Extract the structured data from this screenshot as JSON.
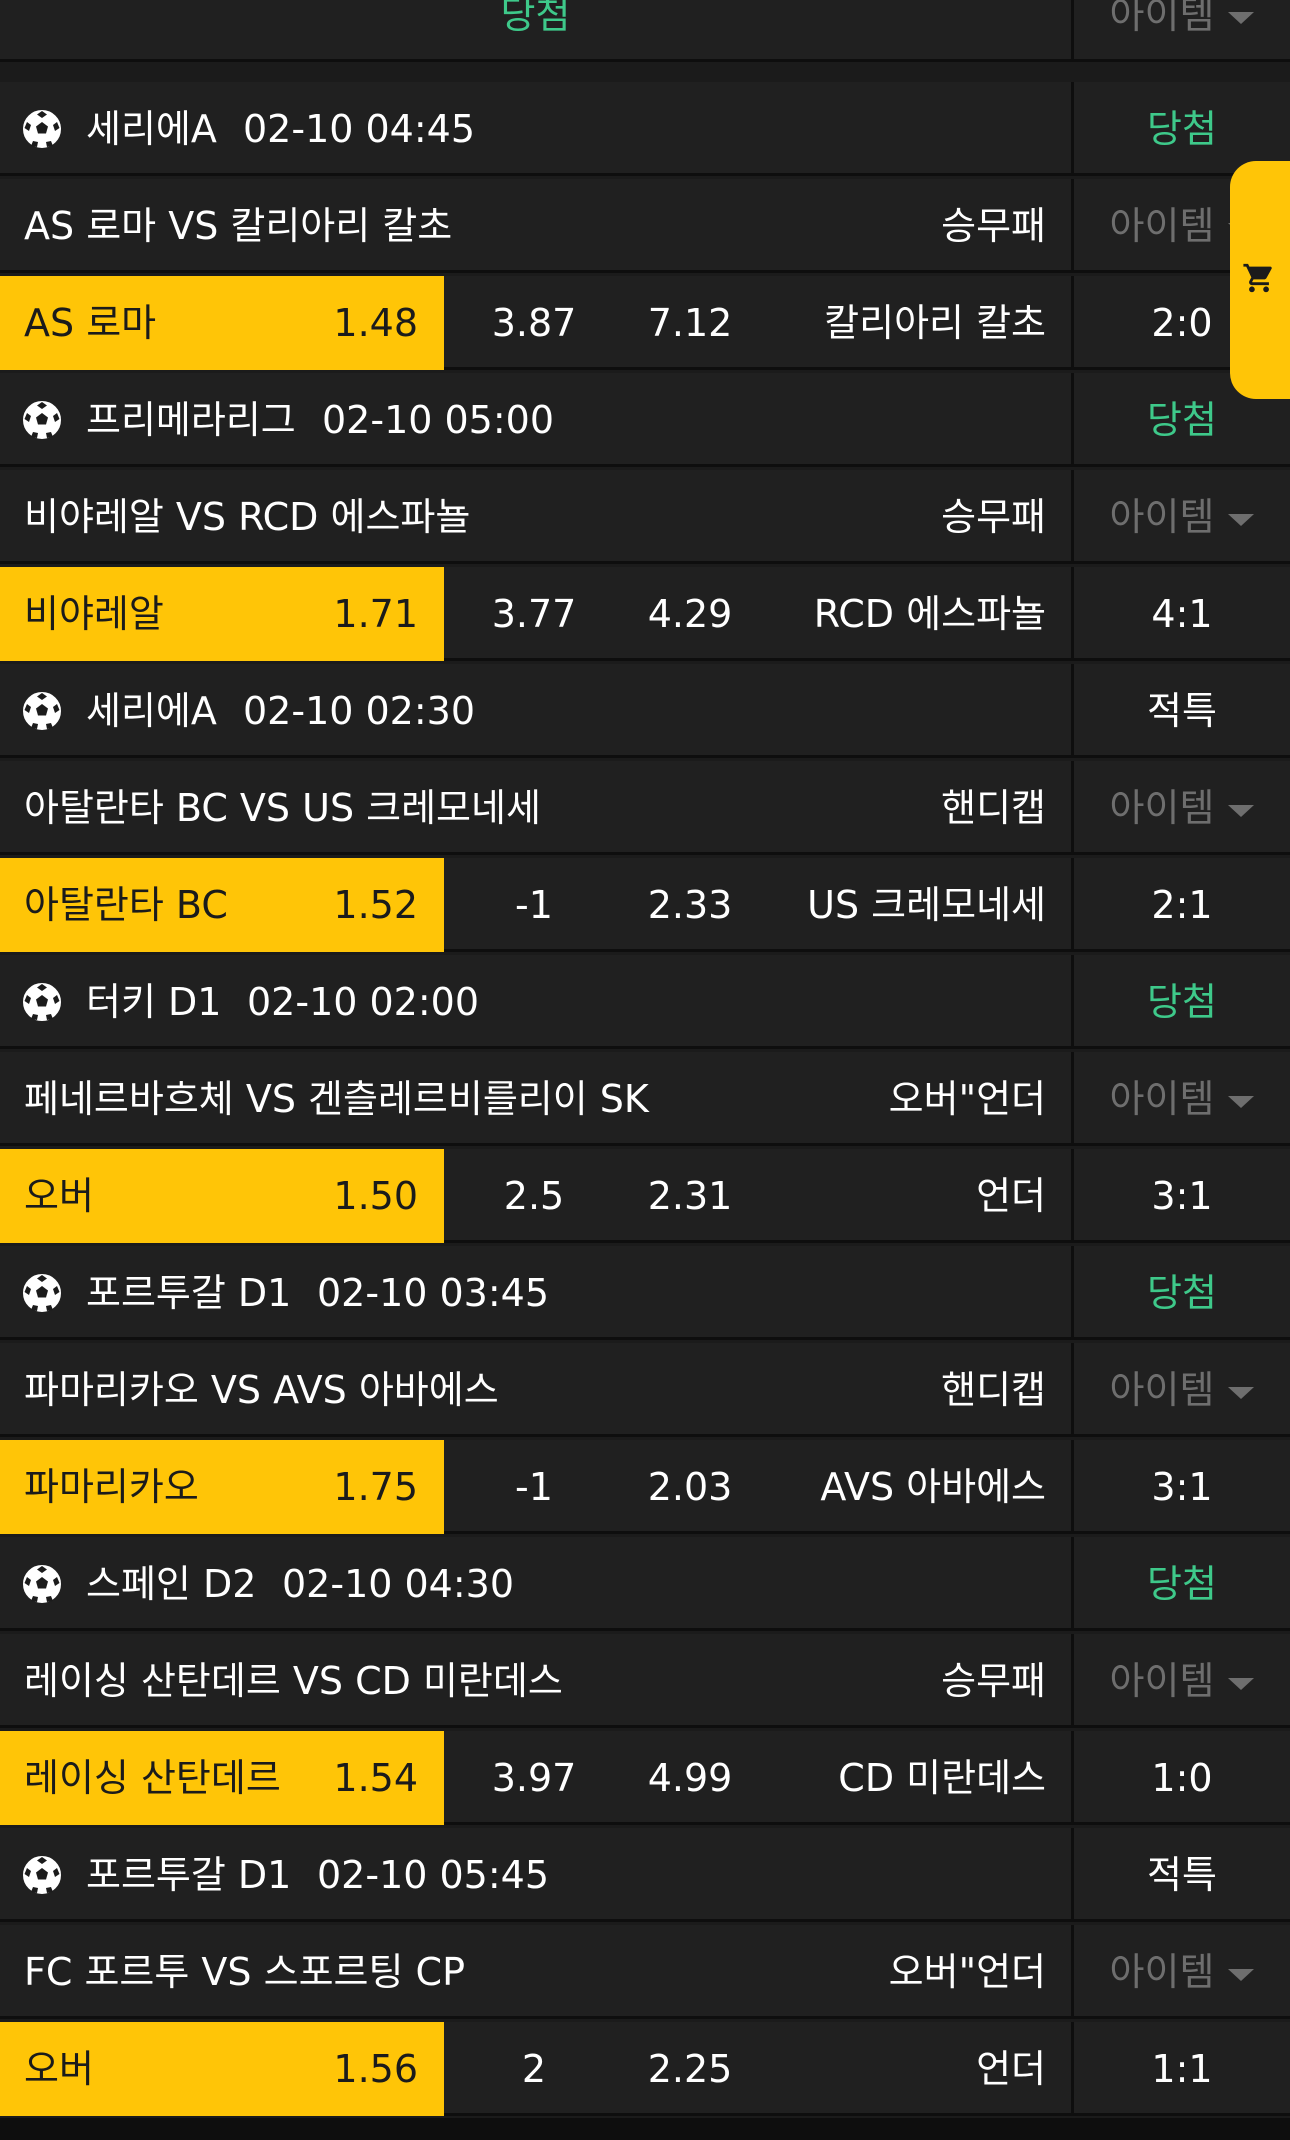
{
  "header": {
    "status": "당첨",
    "item": "아이템"
  },
  "matches": [
    {
      "league": "세리에A",
      "time": "02-10 04:45",
      "status": "당첨",
      "status_color": "green",
      "match_title": "AS 로마 VS 칼리아리 칼초",
      "bet_type": "승무패",
      "item": "아이템",
      "home": "AS 로마",
      "home_odd": "1.48",
      "mid": "3.87",
      "away_odd": "7.12",
      "away": "칼리아리 칼초",
      "score": "2:0"
    },
    {
      "league": "프리메라리그",
      "time": "02-10 05:00",
      "status": "당첨",
      "status_color": "green",
      "match_title": "비야레알 VS RCD 에스파뇰",
      "bet_type": "승무패",
      "item": "아이템",
      "home": "비야레알",
      "home_odd": "1.71",
      "mid": "3.77",
      "away_odd": "4.29",
      "away": "RCD 에스파뇰",
      "score": "4:1"
    },
    {
      "league": "세리에A",
      "time": "02-10 02:30",
      "status": "적특",
      "status_color": "white",
      "match_title": "아탈란타 BC VS US 크레모네세",
      "bet_type": "핸디캡",
      "item": "아이템",
      "home": "아탈란타 BC",
      "home_odd": "1.52",
      "mid": "-1",
      "away_odd": "2.33",
      "away": "US 크레모네세",
      "score": "2:1"
    },
    {
      "league": "터키 D1",
      "time": "02-10 02:00",
      "status": "당첨",
      "status_color": "green",
      "match_title": "페네르바흐체 VS 겐츨레르비를리이 SK",
      "bet_type": "오버\"언더",
      "item": "아이템",
      "home": "오버",
      "home_odd": "1.50",
      "mid": "2.5",
      "away_odd": "2.31",
      "away": "언더",
      "score": "3:1"
    },
    {
      "league": "포르투갈 D1",
      "time": "02-10 03:45",
      "status": "당첨",
      "status_color": "green",
      "match_title": "파마리카오 VS AVS 아바에스",
      "bet_type": "핸디캡",
      "item": "아이템",
      "home": "파마리카오",
      "home_odd": "1.75",
      "mid": "-1",
      "away_odd": "2.03",
      "away": "AVS 아바에스",
      "score": "3:1"
    },
    {
      "league": "스페인 D2",
      "time": "02-10 04:30",
      "status": "당첨",
      "status_color": "green",
      "match_title": "레이싱 산탄데르 VS CD 미란데스",
      "bet_type": "승무패",
      "item": "아이템",
      "home": "레이싱 산탄데르",
      "home_odd": "1.54",
      "mid": "3.97",
      "away_odd": "4.99",
      "away": "CD 미란데스",
      "score": "1:0"
    },
    {
      "league": "포르투갈 D1",
      "time": "02-10 05:45",
      "status": "적특",
      "status_color": "white",
      "match_title": "FC 포르투 VS 스포르팅 CP",
      "bet_type": "오버\"언더",
      "item": "아이템",
      "home": "오버",
      "home_odd": "1.56",
      "mid": "2",
      "away_odd": "2.25",
      "away": "언더",
      "score": "1:1"
    }
  ],
  "colors": {
    "accent": "#ffc507",
    "win": "#3ec98a",
    "background": "#202020",
    "muted": "#6e6e6e"
  },
  "icons": {
    "cart": "cart-icon",
    "ball": "soccer-ball-icon"
  }
}
